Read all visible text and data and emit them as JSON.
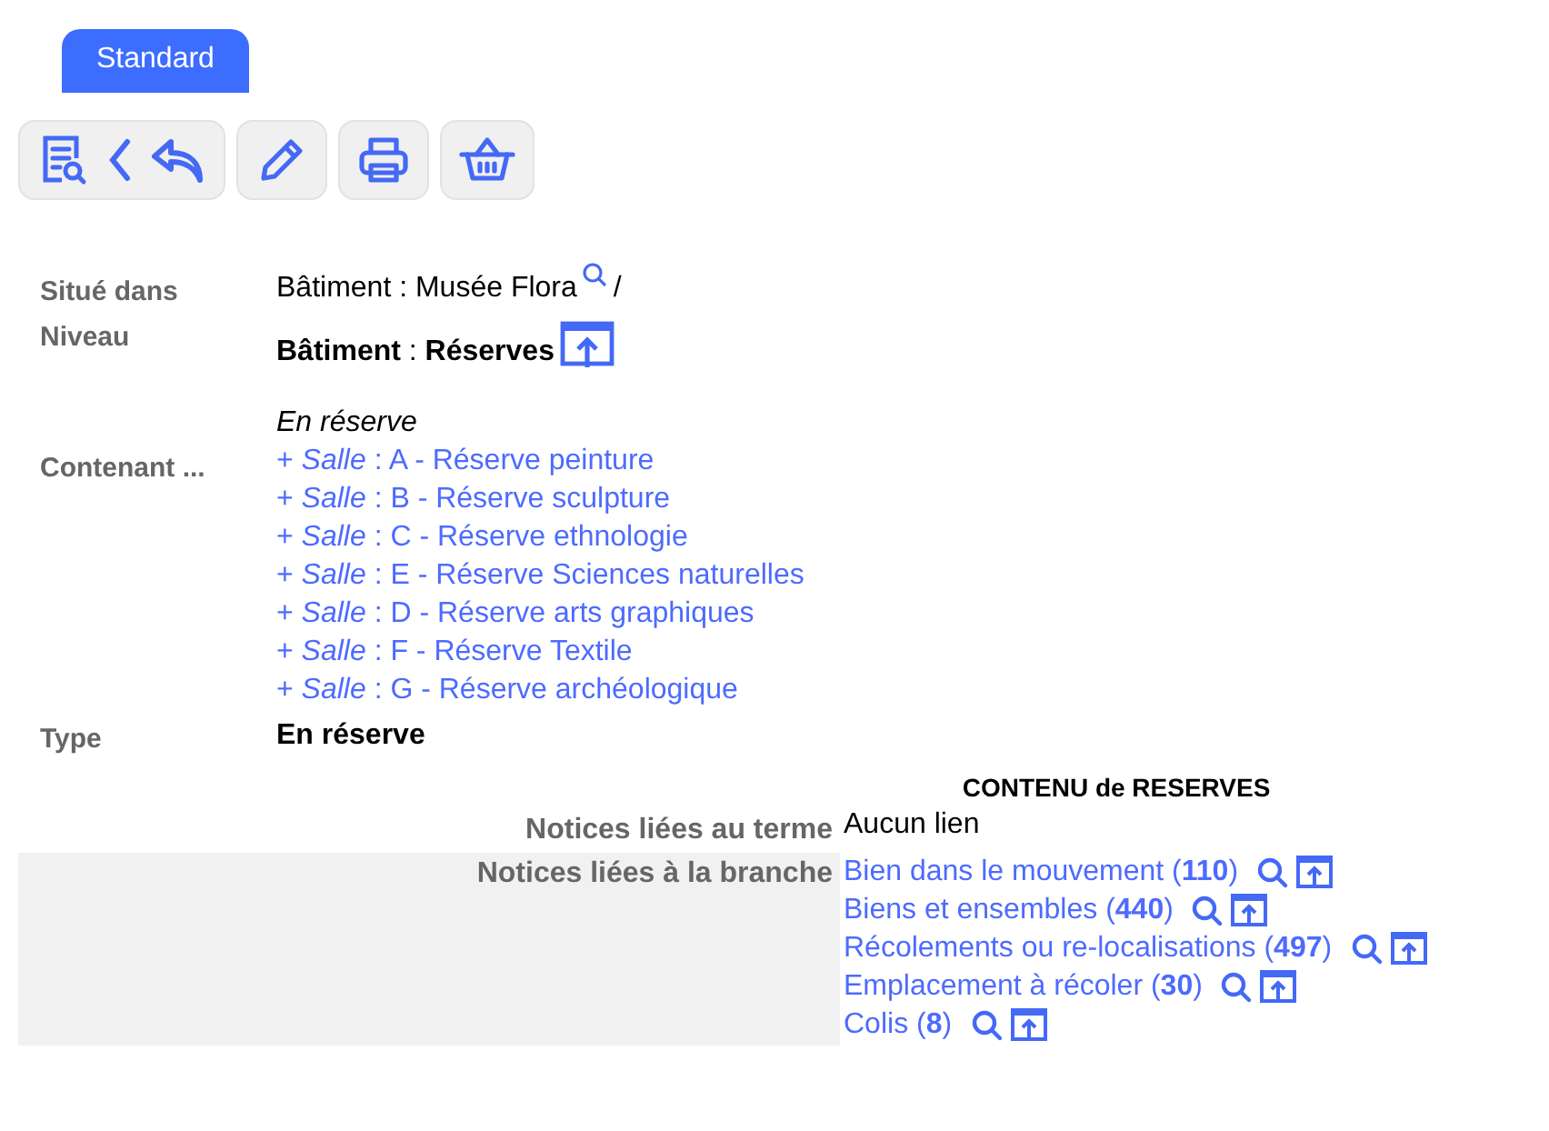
{
  "tabs": [
    {
      "label": "Standard",
      "selected": true
    }
  ],
  "fields": {
    "situe_dans": {
      "label": "Situé dans",
      "value": "Bâtiment : Musée Flora",
      "separator": "/"
    },
    "niveau": {
      "label": "Niveau",
      "value": "**Bâtiment** : **Réserves**"
    },
    "contenant": {
      "label": "Contenant ...",
      "heading": "En réserve",
      "items": [
        "+ *Salle* : A - Réserve peinture",
        "+ *Salle* : B - Réserve sculpture",
        "+ *Salle* : C - Réserve ethnologie",
        "+ *Salle* : E - Réserve Sciences naturelles",
        "+ *Salle* : D - Réserve arts graphiques",
        "+ *Salle* : F - Réserve Textile",
        "+ *Salle* : G - Réserve archéologique"
      ]
    },
    "type": {
      "label": "Type",
      "value": "En réserve"
    }
  },
  "contenu": {
    "title": "CONTENU de RESERVES",
    "term": {
      "label": "Notices liées au terme",
      "value": "Aucun lien"
    },
    "branch": {
      "label": "Notices liées à la branche",
      "links": [
        "Bien dans le mouvement (**110**)",
        "Biens et ensembles (**440**)",
        "Récolements ou re-localisations (**497**)",
        "Emplacement à récoler (**30**)",
        "Colis (**8**)"
      ]
    }
  }
}
